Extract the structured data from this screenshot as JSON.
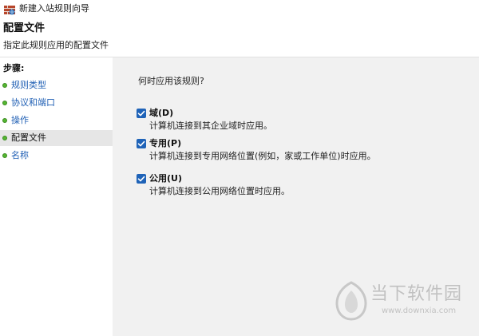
{
  "window": {
    "title": "新建入站规则向导"
  },
  "header": {
    "title": "配置文件",
    "subtitle": "指定此规则应用的配置文件"
  },
  "steps": {
    "heading": "步骤:",
    "items": [
      {
        "label": "规则类型",
        "selected": false
      },
      {
        "label": "协议和端口",
        "selected": false
      },
      {
        "label": "操作",
        "selected": false
      },
      {
        "label": "配置文件",
        "selected": true
      },
      {
        "label": "名称",
        "selected": false
      }
    ]
  },
  "content": {
    "question": "何时应用该规则?",
    "options": [
      {
        "label": "域(D)",
        "description": "计算机连接到其企业域时应用。",
        "checked": true
      },
      {
        "label": "专用(P)",
        "description": "计算机连接到专用网络位置(例如，家或工作单位)时应用。",
        "checked": true
      },
      {
        "label": "公用(U)",
        "description": "计算机连接到公用网络位置时应用。",
        "checked": true
      }
    ]
  },
  "watermark": {
    "name": "当下软件园",
    "url": "www.downxia.com"
  },
  "colors": {
    "accent": "#1f63b8",
    "step_bullet": "#54b631",
    "link": "#1f5fb4",
    "content_bg": "#f1f1f1",
    "selected_bg": "#e6e6e6"
  }
}
